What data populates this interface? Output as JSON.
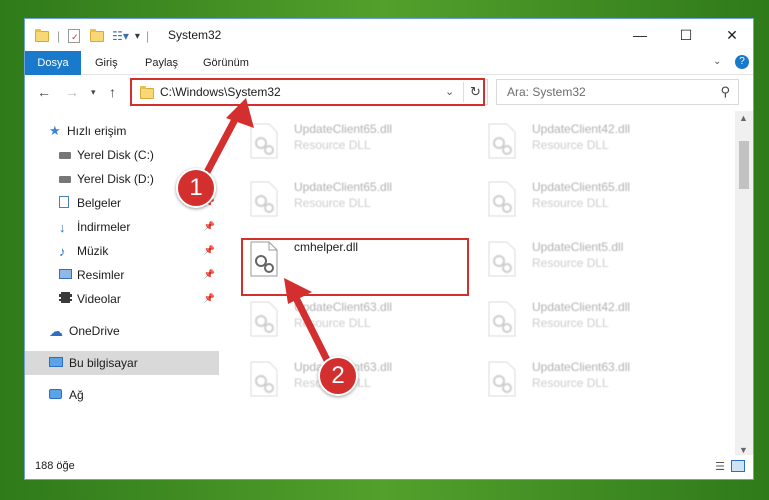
{
  "window": {
    "title": "System32"
  },
  "ribbon": {
    "tabs": [
      "Dosya",
      "Giriş",
      "Paylaş",
      "Görünüm"
    ]
  },
  "address": {
    "path": "C:\\Windows\\System32"
  },
  "search": {
    "placeholder": "Ara: System32"
  },
  "sidebar": {
    "items": [
      {
        "label": "Hızlı erişim",
        "icon": "star-icon",
        "pinned": false
      },
      {
        "label": "Yerel Disk (C:)",
        "icon": "drive-icon",
        "pinned": true
      },
      {
        "label": "Yerel Disk (D:)",
        "icon": "drive-icon",
        "pinned": true
      },
      {
        "label": "Belgeler",
        "icon": "document-icon",
        "pinned": true
      },
      {
        "label": "İndirmeler",
        "icon": "download-icon",
        "pinned": true
      },
      {
        "label": "Müzik",
        "icon": "music-icon",
        "pinned": true
      },
      {
        "label": "Resimler",
        "icon": "picture-icon",
        "pinned": true
      },
      {
        "label": "Videolar",
        "icon": "film-icon",
        "pinned": true
      },
      {
        "label": "OneDrive",
        "icon": "cloud-icon",
        "pinned": false
      },
      {
        "label": "Bu bilgisayar",
        "icon": "computer-icon",
        "pinned": false,
        "selected": true
      },
      {
        "label": "Ağ",
        "icon": "network-icon",
        "pinned": false
      }
    ]
  },
  "files": [
    {
      "name": "UpdateClient65.dll",
      "type": "Resource DLL",
      "blurred": true
    },
    {
      "name": "UpdateClient42.dll",
      "type": "Resource DLL",
      "blurred": true
    },
    {
      "name": "UpdateClient65.dll",
      "type": "Resource DLL",
      "blurred": true
    },
    {
      "name": "UpdateClient65.dll",
      "type": "Resource DLL",
      "blurred": true
    },
    {
      "name": "cmhelper.dll",
      "type": "",
      "blurred": false
    },
    {
      "name": "UpdateClient5.dll",
      "type": "Resource DLL",
      "blurred": true
    },
    {
      "name": "UpdateClient63.dll",
      "type": "Resource DLL",
      "blurred": true
    },
    {
      "name": "UpdateClient42.dll",
      "type": "Resource DLL",
      "blurred": true
    },
    {
      "name": "UpdateClient63.dll",
      "type": "Resource DLL",
      "blurred": true
    },
    {
      "name": "UpdateClient63.dll",
      "type": "Resource DLL",
      "blurred": true
    }
  ],
  "status": {
    "item_count": "188 öğe"
  },
  "annotations": {
    "callout_1": "1",
    "callout_2": "2",
    "highlight_color": "#d32f2f"
  }
}
